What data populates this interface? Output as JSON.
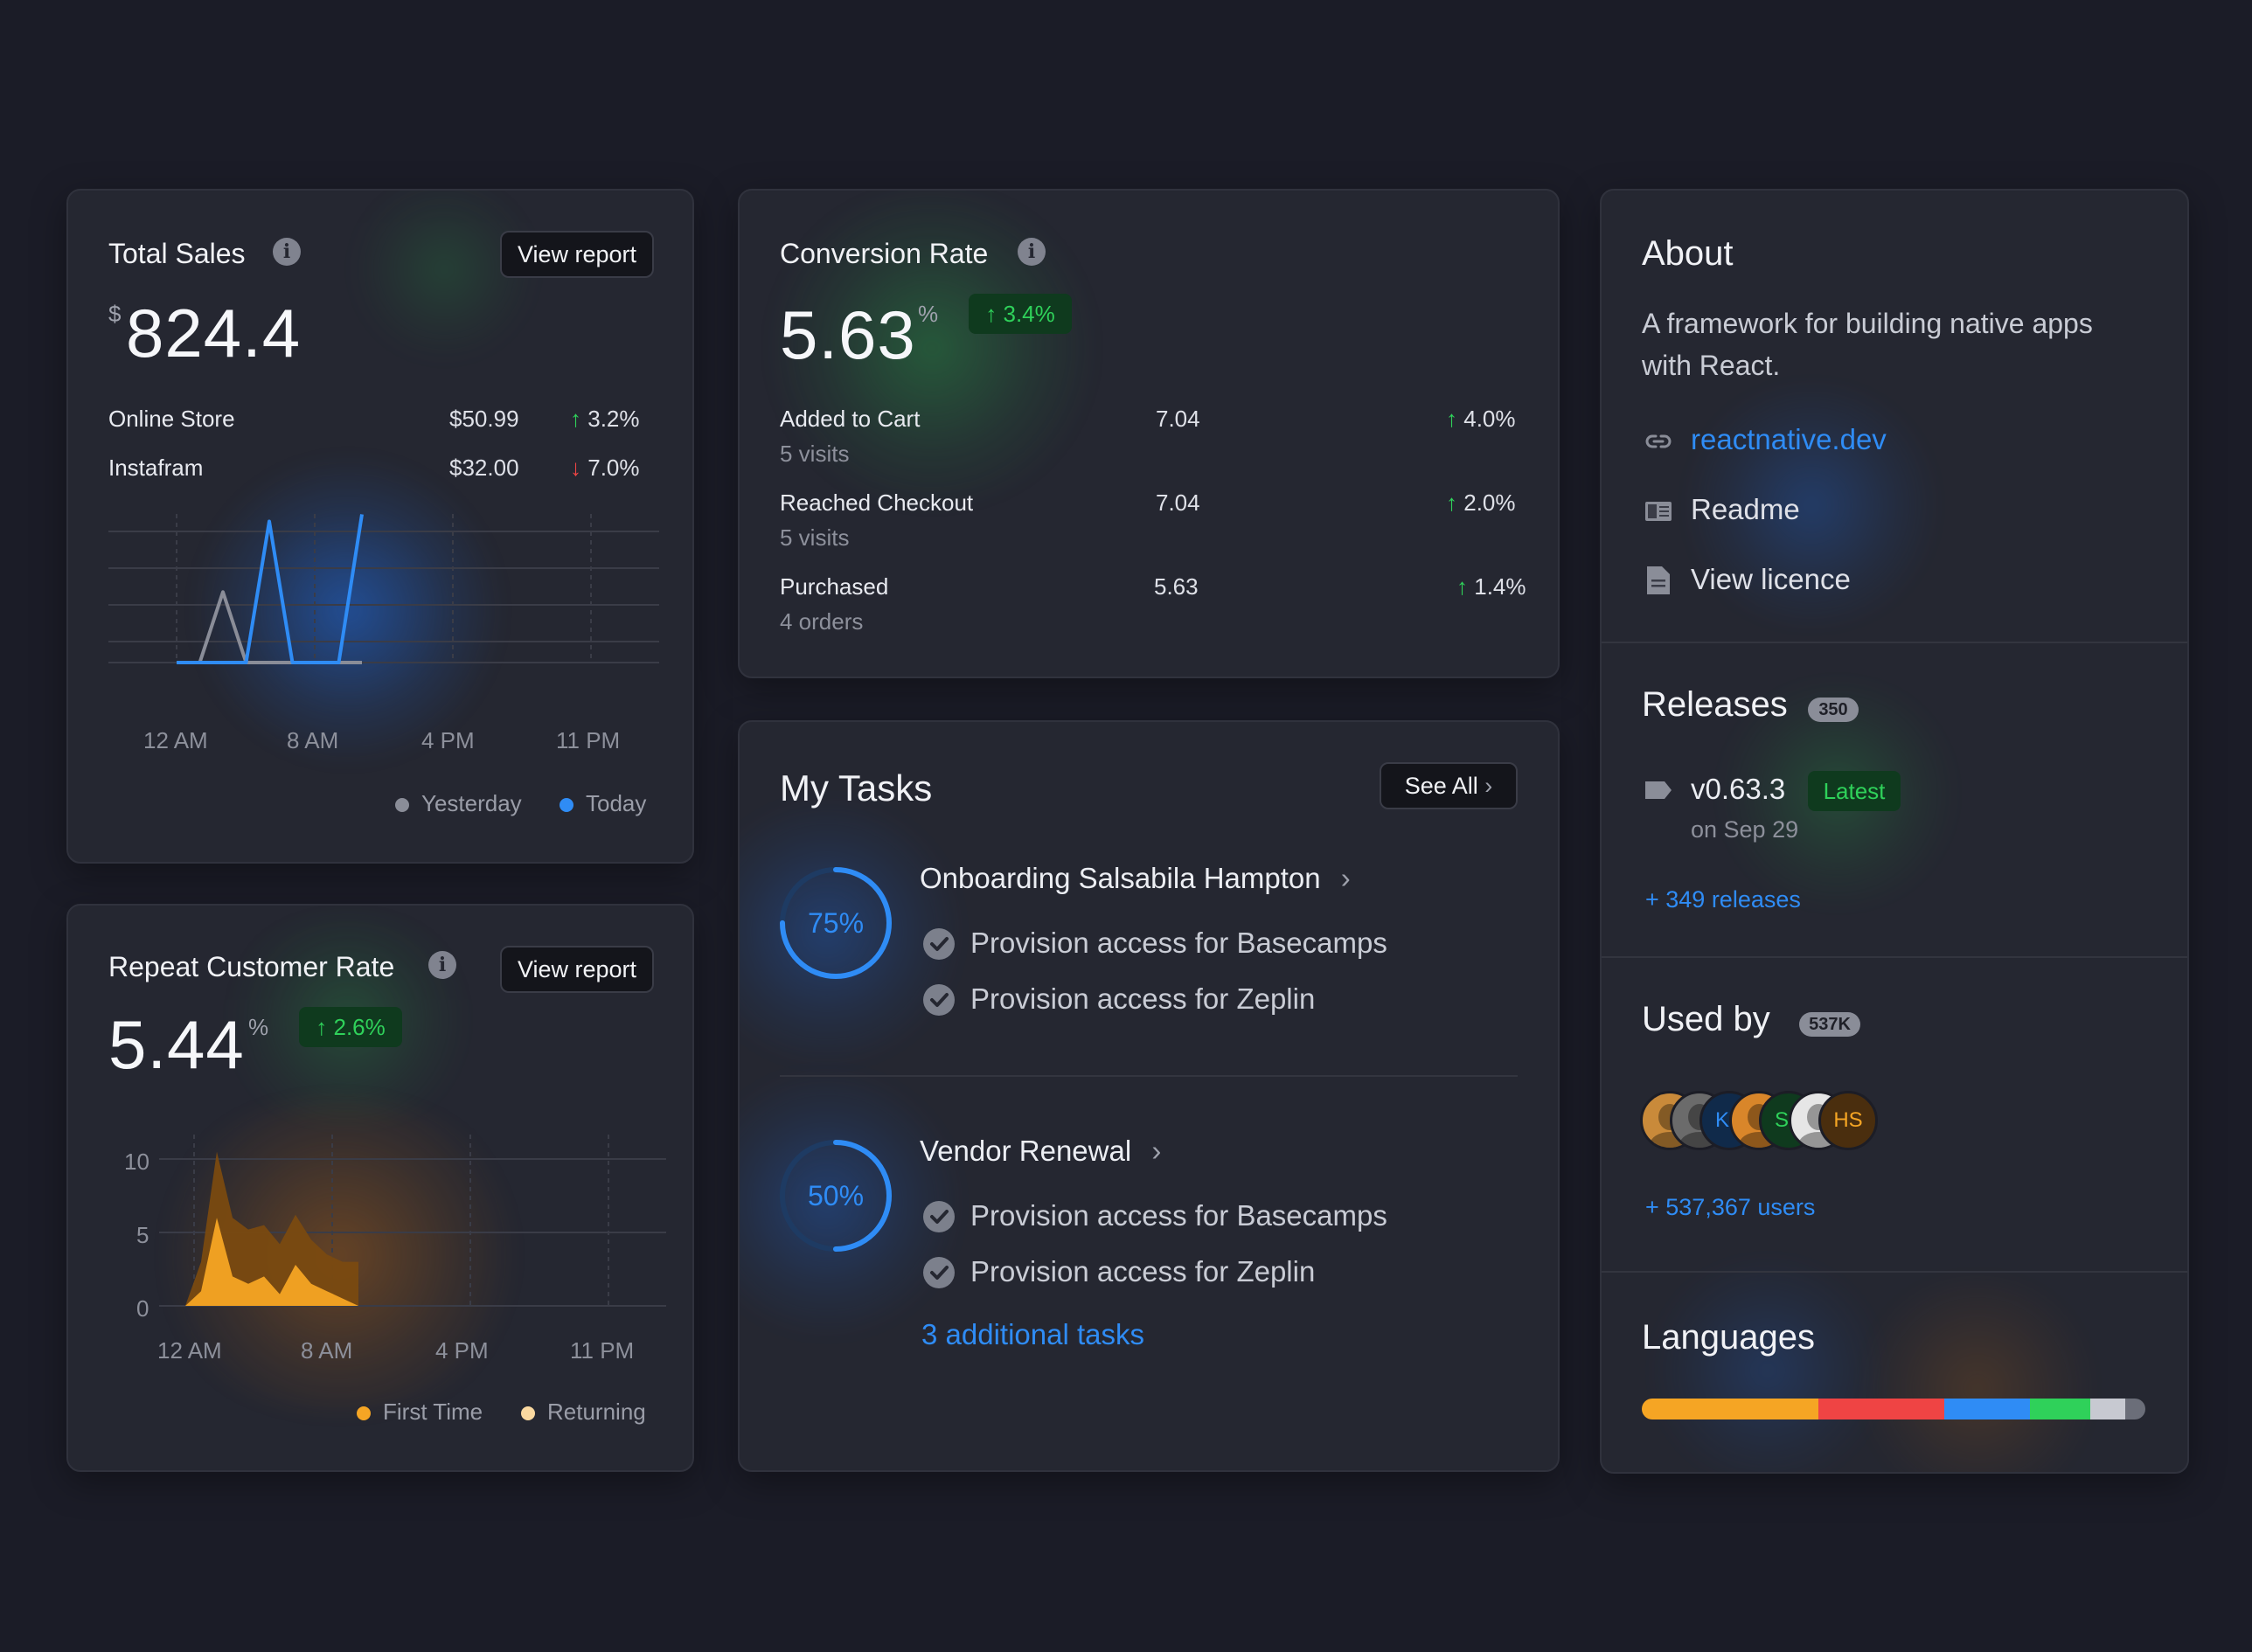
{
  "total_sales": {
    "title": "Total Sales",
    "button": "View report",
    "currency": "$",
    "value": "824.4",
    "rows": [
      {
        "label": "Online Store",
        "amount": "$50.99",
        "change": "3.2%",
        "direction": "up"
      },
      {
        "label": "Instafram",
        "amount": "$32.00",
        "change": "7.0%",
        "direction": "down"
      }
    ],
    "legend": [
      "Yesterday",
      "Today"
    ],
    "chart_data": {
      "type": "line",
      "x_ticks": [
        "12 AM",
        "8 AM",
        "4 PM",
        "11 PM"
      ],
      "series": [
        {
          "name": "Yesterday",
          "color": "#8a8d98",
          "values": [
            0,
            0,
            0.5,
            0,
            0,
            0,
            0,
            0,
            0
          ]
        },
        {
          "name": "Today",
          "color": "#2f8cf5",
          "values": [
            0,
            0,
            0,
            0,
            1,
            0,
            0,
            0,
            1.05
          ]
        }
      ]
    }
  },
  "repeat_customer": {
    "title": "Repeat Customer Rate",
    "button": "View report",
    "value": "5.44",
    "unit": "%",
    "change": "2.6%",
    "legend": [
      "First Time",
      "Returning"
    ],
    "chart_data": {
      "type": "area",
      "x_ticks": [
        "12 AM",
        "8 AM",
        "4 PM",
        "11 PM"
      ],
      "y_ticks": [
        "10",
        "5",
        "0"
      ],
      "ylim": [
        0,
        10
      ],
      "series": [
        {
          "name": "First Time",
          "color": "#f5a524",
          "values": [
            0,
            1,
            6,
            2,
            1.5,
            2,
            0.8,
            2.8,
            1.5,
            1,
            0.5,
            0
          ]
        },
        {
          "name": "Returning",
          "color": "#7a4a10",
          "values": [
            0,
            3,
            10.5,
            6,
            5.2,
            5.5,
            4.2,
            6.2,
            4.5,
            3.5,
            3,
            3
          ]
        }
      ]
    }
  },
  "conversion": {
    "title": "Conversion Rate",
    "value": "5.63",
    "unit": "%",
    "change": "3.4%",
    "rows": [
      {
        "label": "Added to Cart",
        "sub": "5 visits",
        "value": "7.04",
        "change": "4.0%"
      },
      {
        "label": "Reached Checkout",
        "sub": "5 visits",
        "value": "7.04",
        "change": "2.0%"
      },
      {
        "label": "Purchased",
        "sub": "4 orders",
        "value": "5.63",
        "change": "1.4%"
      }
    ]
  },
  "tasks": {
    "title": "My Tasks",
    "see_all": "See All",
    "groups": [
      {
        "progress": "75%",
        "fraction": 0.75,
        "title": "Onboarding Salsabila Hampton",
        "items": [
          "Provision access for Basecamps",
          "Provision access for Zeplin"
        ]
      },
      {
        "progress": "50%",
        "fraction": 0.5,
        "title": "Vendor Renewal",
        "items": [
          "Provision access for Basecamps",
          "Provision access for Zeplin"
        ]
      }
    ],
    "more": "3 additional tasks"
  },
  "about": {
    "title": "About",
    "description_line1": "A framework for building native apps",
    "description_line2": "with React.",
    "link": "reactnative.dev",
    "readme": "Readme",
    "license": "View licence"
  },
  "releases": {
    "title": "Releases",
    "count": "350",
    "version": "v0.63.3",
    "tag": "Latest",
    "date": "on Sep 29",
    "more": "+ 349 releases"
  },
  "used_by": {
    "title": "Used by",
    "count": "537K",
    "avatars": [
      {
        "initials": "",
        "bg": "#c98a3a"
      },
      {
        "initials": "",
        "bg": "#6b6b6b"
      },
      {
        "initials": "KK",
        "bg": "#102a4a",
        "color": "#2f8cf5"
      },
      {
        "initials": "",
        "bg": "#d9862a"
      },
      {
        "initials": "SK",
        "bg": "#0f3a1e",
        "color": "#2fd15a"
      },
      {
        "initials": "",
        "bg": "#e6e6e6"
      },
      {
        "initials": "HS",
        "bg": "#4a2e0e",
        "color": "#f5a524"
      }
    ],
    "more": "+ 537,367 users"
  },
  "languages": {
    "title": "Languages",
    "segments": [
      {
        "share": 35,
        "color": "#f5a524"
      },
      {
        "share": 25,
        "color": "#ef4444"
      },
      {
        "share": 17,
        "color": "#2f8cf5"
      },
      {
        "share": 12,
        "color": "#2fd15a"
      },
      {
        "share": 7,
        "color": "#c7c9d1"
      },
      {
        "share": 4,
        "color": "#6b6e79"
      }
    ]
  }
}
